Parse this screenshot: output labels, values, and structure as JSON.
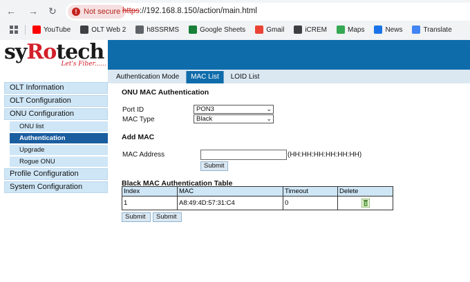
{
  "browser": {
    "security_label": "Not secure",
    "url_scheme": "https",
    "url_rest": "://192.168.8.150/action/main.html",
    "bookmarks": [
      {
        "label": "YouTube",
        "color": "#ff0000"
      },
      {
        "label": "OLT Web 2",
        "color": "#3c4043"
      },
      {
        "label": "h8SSRMS",
        "color": "#5f6368"
      },
      {
        "label": "Google Sheets",
        "color": "#188038"
      },
      {
        "label": "Gmail",
        "color": "#ea4335"
      },
      {
        "label": "iCREM",
        "color": "#3c4043"
      },
      {
        "label": "Maps",
        "color": "#34a853"
      },
      {
        "label": "News",
        "color": "#1a73e8"
      },
      {
        "label": "Translate",
        "color": "#4285f4"
      }
    ]
  },
  "logo": {
    "brand_pre": "syRo",
    "brand_post": "tech",
    "tagline": "Let's Fiber......"
  },
  "tabs": [
    {
      "label": "Authentication Mode",
      "active": false
    },
    {
      "label": "MAC List",
      "active": true
    },
    {
      "label": "LOID List",
      "active": false
    }
  ],
  "sidebar": {
    "items": [
      {
        "label": "OLT Information",
        "level": 0
      },
      {
        "label": "OLT Configuration",
        "level": 0
      },
      {
        "label": "ONU Configuration",
        "level": 0
      },
      {
        "label": "ONU list",
        "level": 1
      },
      {
        "label": "Authentication",
        "level": 1,
        "active": true
      },
      {
        "label": "Upgrade",
        "level": 1
      },
      {
        "label": "Rogue ONU",
        "level": 1
      },
      {
        "label": "Profile Configuration",
        "level": 0
      },
      {
        "label": "System Configuration",
        "level": 0
      }
    ]
  },
  "content": {
    "section_title": "ONU MAC Authentication",
    "port_id_label": "Port ID",
    "port_id_value": "PON3",
    "mac_type_label": "MAC Type",
    "mac_type_value": "Black",
    "add_mac_title": "Add MAC",
    "mac_address_label": "MAC Address",
    "mac_address_value": "",
    "mac_format_hint": "(HH:HH:HH:HH:HH:HH)",
    "add_submit_label": "Submit",
    "table_title": "Black MAC Authentication Table",
    "table_headers": [
      "Index",
      "MAC",
      "Timeout",
      "Delete"
    ],
    "table_rows": [
      {
        "index": "1",
        "mac": "A8:49:4D:57:31:C4",
        "timeout": "0"
      }
    ],
    "bottom_submit_1": "Submit",
    "bottom_submit_2": "Submit"
  },
  "colors": {
    "brand_blue": "#0f6cab",
    "active_menu": "#1b5ea0",
    "menu_bg": "#cfe6f6",
    "logo_red": "#d31f2a"
  }
}
